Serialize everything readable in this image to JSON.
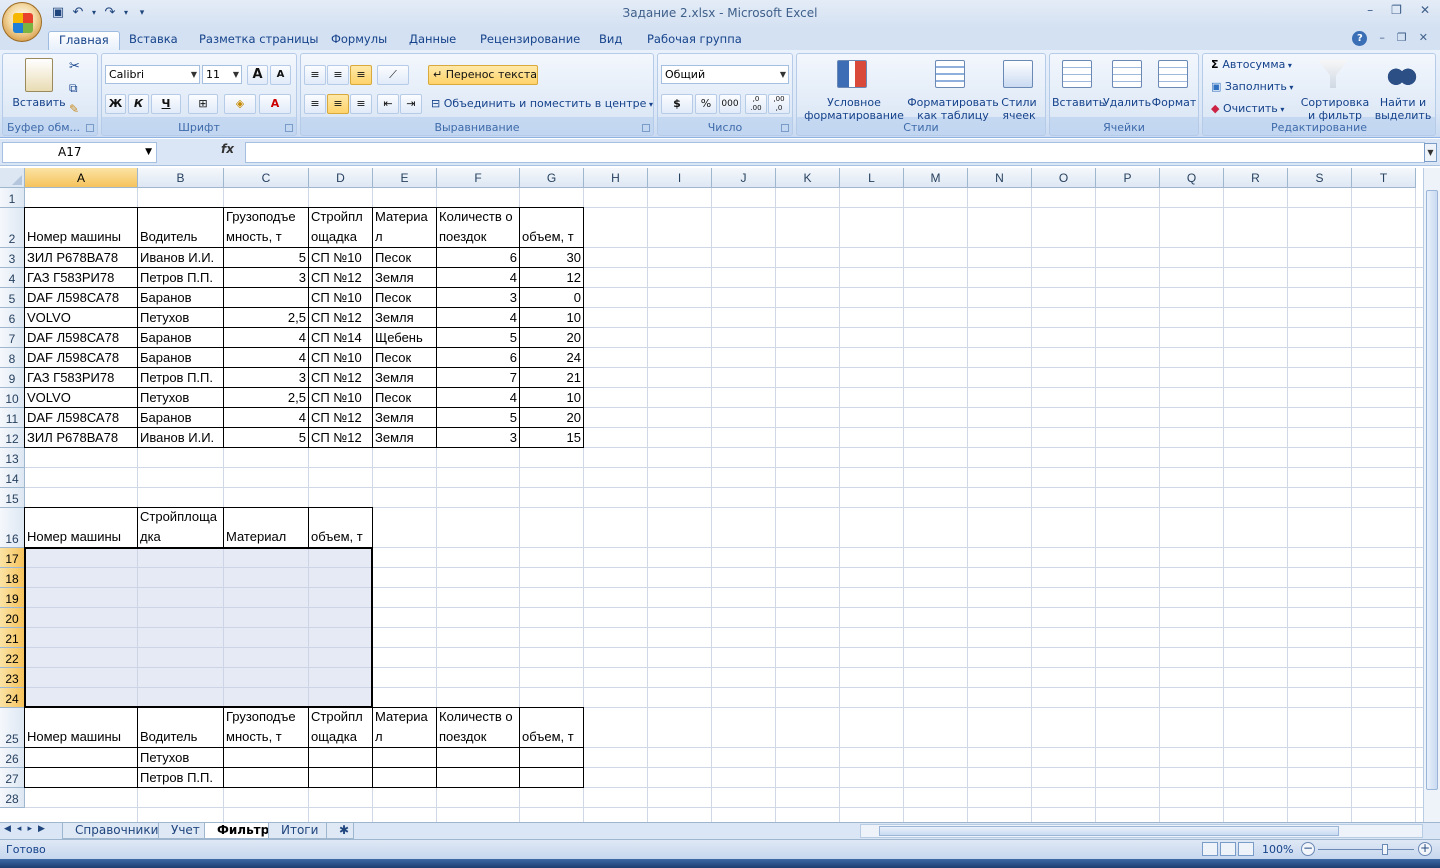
{
  "window": {
    "title": "Задание 2.xlsx - Microsoft Excel"
  },
  "ribbon_tabs": [
    "Главная",
    "Вставка",
    "Разметка страницы",
    "Формулы",
    "Данные",
    "Рецензирование",
    "Вид",
    "Рабочая группа"
  ],
  "ribbon": {
    "clipboard": {
      "paste": "Вставить",
      "label": "Буфер обм..."
    },
    "font": {
      "name": "Calibri",
      "size": "11",
      "bold": "Ж",
      "italic": "К",
      "underline": "Ч",
      "grow": "A",
      "shrink": "A",
      "label": "Шрифт"
    },
    "alignment": {
      "wrap": "Перенос текста",
      "merge": "Объединить и поместить в центре",
      "label": "Выравнивание"
    },
    "number": {
      "format": "Общий",
      "currency": "$",
      "percent": "%",
      "thousands": "000",
      "inc": ",0 .00",
      "dec": ",00 ,0",
      "label": "Число"
    },
    "styles": {
      "conditional": "Условное форматирование",
      "table": "Форматировать как таблицу",
      "cell": "Стили ячеек",
      "label": "Стили"
    },
    "cells": {
      "insert": "Вставить",
      "delete": "Удалить",
      "format": "Формат",
      "label": "Ячейки"
    },
    "editing": {
      "autosum": "Автосумма",
      "fill": "Заполнить",
      "clear": "Очистить",
      "sort": "Сортировка и фильтр",
      "find": "Найти и выделить",
      "label": "Редактирование"
    }
  },
  "formula_bar": {
    "name_box": "A17",
    "fx": "fx",
    "value": ""
  },
  "columns": [
    "A",
    "B",
    "C",
    "D",
    "E",
    "F",
    "G",
    "H",
    "I",
    "J",
    "K",
    "L",
    "M",
    "N",
    "O",
    "P",
    "Q",
    "R",
    "S",
    "T"
  ],
  "selected_cell": "A17",
  "rows": [
    "1",
    "2",
    "3",
    "4",
    "5",
    "6",
    "7",
    "8",
    "9",
    "10",
    "11",
    "12",
    "13",
    "14",
    "15",
    "16",
    "17",
    "18",
    "19",
    "20",
    "21",
    "22",
    "23",
    "24",
    "25",
    "26",
    "27",
    "28"
  ],
  "table1": {
    "headers": [
      "Номер машины",
      "Водитель",
      "Грузоподъе мность, т",
      "Стройпл ощадка",
      "Материа л",
      "Количеств о поездок",
      "объем, т"
    ],
    "rows": [
      [
        "ЗИЛ Р678ВА78",
        "Иванов И.И.",
        "5",
        "СП №10",
        "Песок",
        "6",
        "30"
      ],
      [
        "ГАЗ Г583РИ78",
        "Петров  П.П.",
        "3",
        "СП №12",
        "Земля",
        "4",
        "12"
      ],
      [
        "DAF Л598СА78",
        "Баранов",
        "",
        "СП №10",
        "Песок",
        "3",
        "0"
      ],
      [
        "VOLVO",
        "Петухов",
        "2,5",
        "СП №12",
        "Земля",
        "4",
        "10"
      ],
      [
        "DAF Л598СА78",
        "Баранов",
        "4",
        "СП №14",
        "Щебень",
        "5",
        "20"
      ],
      [
        "DAF Л598СА78",
        "Баранов",
        "4",
        "СП №10",
        "Песок",
        "6",
        "24"
      ],
      [
        "ГАЗ Г583РИ78",
        "Петров  П.П.",
        "3",
        "СП №12",
        "Земля",
        "7",
        "21"
      ],
      [
        "VOLVO",
        "Петухов",
        "2,5",
        "СП №10",
        "Песок",
        "4",
        "10"
      ],
      [
        "DAF Л598СА78",
        "Баранов",
        "4",
        "СП №12",
        "Земля",
        "5",
        "20"
      ],
      [
        "ЗИЛ Р678ВА78",
        "Иванов И.И.",
        "5",
        "СП №12",
        "Земля",
        "3",
        "15"
      ]
    ]
  },
  "table2": {
    "headers": [
      "Номер машины",
      "Стройплоща дка",
      "Материал",
      "объем, т"
    ]
  },
  "table3": {
    "headers": [
      "Номер машины",
      "Водитель",
      "Грузоподъе мность, т",
      "Стройпл ощадка",
      "Материа л",
      "Количеств о поездок",
      "объем, т"
    ],
    "rows": [
      [
        "",
        "Петухов",
        "",
        "",
        "",
        "",
        ""
      ],
      [
        "",
        "Петров  П.П.",
        "",
        "",
        "",
        "",
        ""
      ]
    ]
  },
  "sheets": [
    "Справочники",
    "Учет",
    "Фильтр",
    "Итоги"
  ],
  "active_sheet": "Фильтр",
  "status": {
    "ready": "Готово",
    "zoom": "100%"
  }
}
